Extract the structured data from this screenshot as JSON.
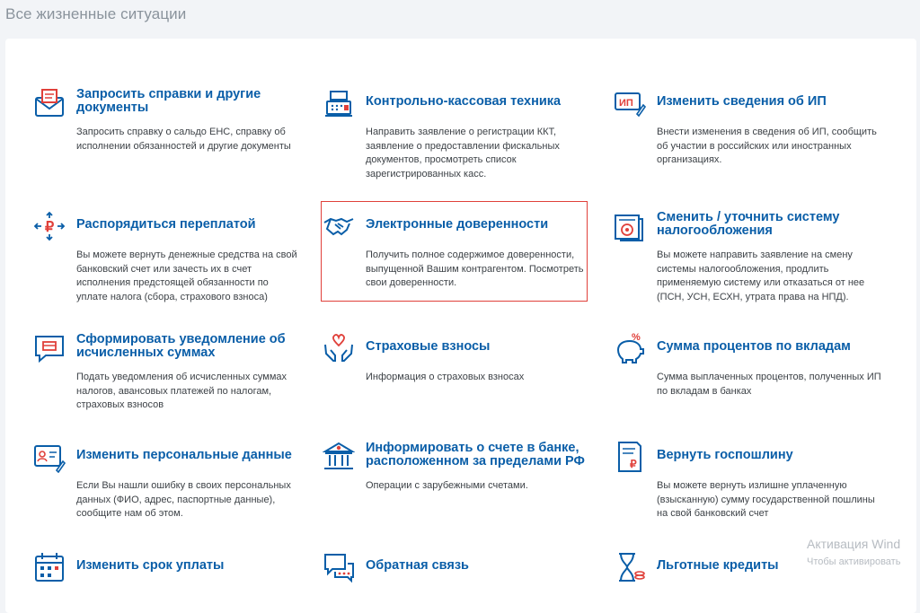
{
  "page": {
    "title": "Все жизненные ситуации"
  },
  "items": [
    {
      "title": "Запросить справки и другие документы",
      "desc": "Запросить справку о сальдо ЕНС, справку об исполнении обязанностей и другие документы",
      "icon": "envelope-document-icon"
    },
    {
      "title": "Контрольно-кассовая техника",
      "desc": "Направить заявление о регистрации ККТ, заявление о предоставлении фискальных документов, просмотреть список зарегистрированных касс.",
      "icon": "cash-register-icon"
    },
    {
      "title": "Изменить сведения об ИП",
      "desc": "Внести изменения в сведения об ИП, сообщить об участии в российских или иностранных организациях.",
      "icon": "ip-edit-icon"
    },
    {
      "title": "Распорядиться переплатой",
      "desc": "Вы можете вернуть денежные средства на свой банковский счет или зачесть их в счет исполнения предстоящей обязанности по уплате налога (сбора, страхового взноса)",
      "icon": "ruble-arrows-icon"
    },
    {
      "title": "Электронные доверенности",
      "desc": "Получить полное содержимое доверенности, выпущенной Вашим контрагентом. Посмотреть свои доверенности.",
      "icon": "handshake-icon"
    },
    {
      "title": "Сменить / уточнить систему налогообложения",
      "desc": "Вы можете направить заявление на смену системы налогообложения, продлить применяемую систему или отказаться от нее (ПСН, УСН, ЕСХН, утрата права на НПД).",
      "icon": "tax-documents-icon"
    },
    {
      "title": "Сформировать уведомление об исчисленных суммах",
      "desc": "Подать уведомления об исчисленных суммах налогов, авансовых платежей по налогам, страховых взносов",
      "icon": "notification-bubble-icon"
    },
    {
      "title": "Страховые взносы",
      "desc": "Информация о страховых взносах",
      "icon": "hands-heart-icon"
    },
    {
      "title": "Сумма процентов по вкладам",
      "desc": "Сумма выплаченных процентов, полученных ИП по вкладам в банках",
      "icon": "piggy-bank-icon"
    },
    {
      "title": "Изменить персональные данные",
      "desc": "Если Вы нашли ошибку в своих персональных данных (ФИО, адрес, паспортные данные), сообщите нам об этом.",
      "icon": "id-card-edit-icon"
    },
    {
      "title": "Информировать о счете в банке, расположенном за пределами РФ",
      "desc": "Операции с зарубежными счетами.",
      "icon": "bank-building-icon"
    },
    {
      "title": "Вернуть госпошлину",
      "desc": "Вы можете вернуть излишне уплаченную (взысканную) сумму государственной пошлины на свой банковский счет",
      "icon": "receipt-ruble-icon"
    },
    {
      "title": "Изменить срок уплаты",
      "desc": "",
      "icon": "calendar-icon"
    },
    {
      "title": "Обратная связь",
      "desc": "",
      "icon": "chat-icon"
    },
    {
      "title": "Льготные кредиты",
      "desc": "",
      "icon": "hourglass-coins-icon"
    }
  ],
  "watermark": {
    "title": "Активация Wind",
    "subtitle": "Чтобы активировать"
  },
  "colors": {
    "accent": "#0a5ea8",
    "icon_red": "#e0403a",
    "highlight": "#e0403a"
  }
}
